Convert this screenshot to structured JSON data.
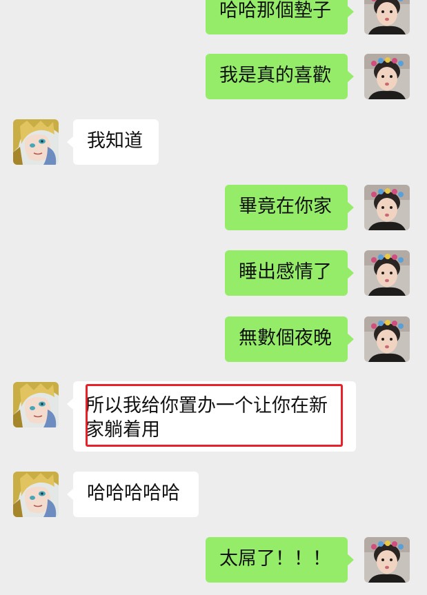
{
  "messages": [
    {
      "side": "right",
      "text": "哈哈那個墊子"
    },
    {
      "side": "right",
      "text": "我是真的喜歡"
    },
    {
      "side": "left",
      "text": "我知道"
    },
    {
      "side": "right",
      "text": "畢竟在你家"
    },
    {
      "side": "right",
      "text": "睡出感情了"
    },
    {
      "side": "right",
      "text": "無數個夜晚"
    },
    {
      "side": "left",
      "text": "所以我给你置办一个让你在新家躺着用"
    },
    {
      "side": "left",
      "text": "哈哈哈哈哈"
    },
    {
      "side": "right",
      "text": "太屌了！！！"
    }
  ],
  "avatars": {
    "left": "cartoon-girl-avatar-icon",
    "right": "child-photo-avatar-icon"
  },
  "colors": {
    "background": "#ededed",
    "sent_bubble": "#95ec69",
    "received_bubble": "#ffffff",
    "highlight": "#e8202a"
  }
}
